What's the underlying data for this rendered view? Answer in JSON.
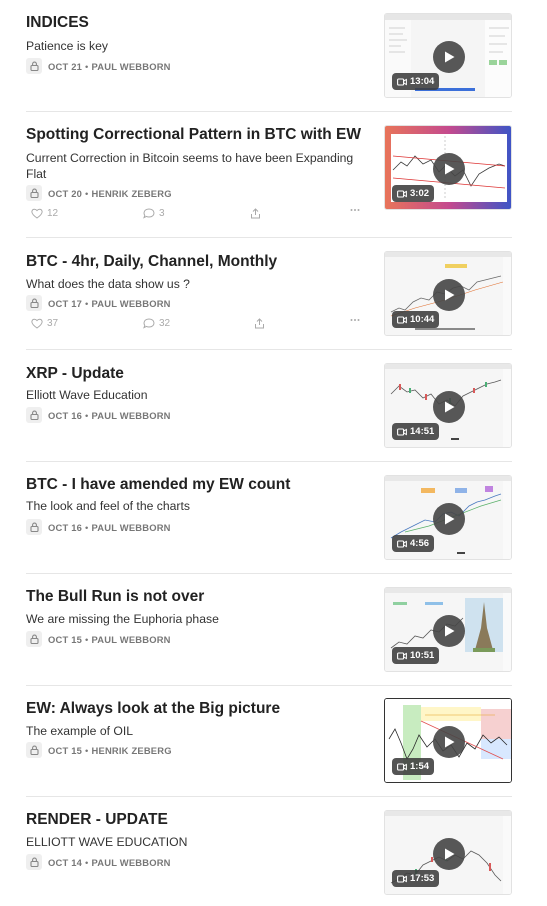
{
  "posts": [
    {
      "title": "INDICES",
      "subtitle": "Patience is key",
      "date": "OCT 21",
      "author": "PAUL WEBBORN",
      "duration": "13:04",
      "likes": "",
      "comments": "",
      "thumb_style": "screen"
    },
    {
      "title": "Spotting Correctional Pattern in BTC with EW",
      "subtitle": "Current Correction in Bitcoin seems to have been Expanding Flat",
      "date": "OCT 20",
      "author": "HENRIK ZEBERG",
      "duration": "3:02",
      "likes": "12",
      "comments": "3",
      "thumb_style": "colorful"
    },
    {
      "title": "BTC - 4hr, Daily, Channel, Monthly",
      "subtitle": "What does the data show us ?",
      "date": "OCT 17",
      "author": "PAUL WEBBORN",
      "duration": "10:44",
      "likes": "37",
      "comments": "32",
      "thumb_style": "chart"
    },
    {
      "title": "XRP - Update",
      "subtitle": "Elliott Wave Education",
      "date": "OCT 16",
      "author": "PAUL WEBBORN",
      "duration": "14:51",
      "likes": "",
      "comments": "",
      "thumb_style": "chart"
    },
    {
      "title": "BTC - I have amended my EW count",
      "subtitle": "The look and feel of the charts",
      "date": "OCT 16",
      "author": "PAUL WEBBORN",
      "duration": "4:56",
      "likes": "",
      "comments": "",
      "thumb_style": "chart"
    },
    {
      "title": "The Bull Run is not over",
      "subtitle": "We are missing the Euphoria phase",
      "date": "OCT 15",
      "author": "PAUL WEBBORN",
      "duration": "10:51",
      "likes": "",
      "comments": "",
      "thumb_style": "eiffel"
    },
    {
      "title": "EW: Always look at the Big picture",
      "subtitle": "The example of OIL",
      "date": "OCT 15",
      "author": "HENRIK ZEBERG",
      "duration": "1:54",
      "likes": "",
      "comments": "",
      "thumb_style": "oil"
    },
    {
      "title": "RENDER - UPDATE",
      "subtitle": "ELLIOTT WAVE EDUCATION",
      "date": "OCT 14",
      "author": "PAUL WEBBORN",
      "duration": "17:53",
      "likes": "",
      "comments": "",
      "thumb_style": "chart"
    }
  ],
  "colors": {
    "text": "#222222",
    "meta": "#777777",
    "divider": "#e6e6e6",
    "action": "#aaaaaa"
  },
  "icons": {
    "lock": "lock-icon",
    "video": "video-camera-icon",
    "play": "play-icon",
    "like": "heart-icon",
    "comment": "comment-icon",
    "share": "share-icon",
    "more": "more-icon"
  }
}
